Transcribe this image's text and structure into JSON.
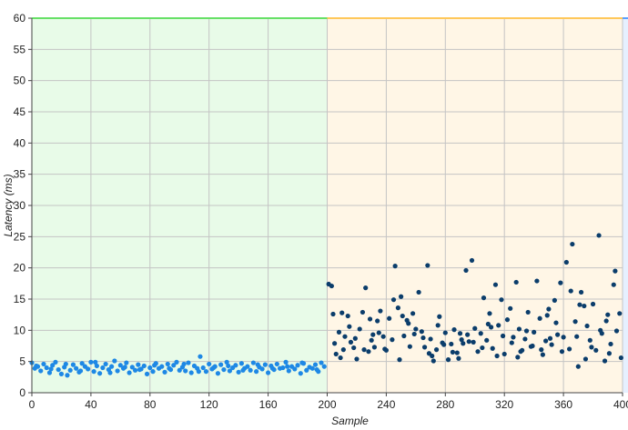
{
  "chart_data": {
    "type": "scatter",
    "xlabel": "Sample",
    "ylabel": "Latency (ms)",
    "xlim": [
      0,
      400
    ],
    "ylim": [
      0,
      60
    ],
    "x_ticks": [
      "0",
      "40",
      "80",
      "120",
      "160",
      "200",
      "240",
      "280",
      "320",
      "360",
      "400"
    ],
    "y_ticks": [
      "0",
      "5",
      "10",
      "15",
      "20",
      "25",
      "30",
      "35",
      "40",
      "45",
      "50",
      "55",
      "60"
    ],
    "grid": true,
    "regions": [
      {
        "x_start": 0,
        "x_end": 200,
        "fill": "#e8fbe8",
        "top_line": "#66e066"
      },
      {
        "x_start": 200,
        "x_end": 400,
        "fill": "#fff6e6",
        "top_line": "#ffc85a"
      },
      {
        "x_start": 400,
        "x_end": 404,
        "fill": "#e6f0ff",
        "top_line": "#5aa0ff"
      }
    ],
    "series": [
      {
        "color": "#1e88e5",
        "points": [
          [
            0,
            4.8
          ],
          [
            2,
            3.9
          ],
          [
            4,
            4.2
          ],
          [
            6,
            3.5
          ],
          [
            8,
            4.6
          ],
          [
            10,
            4.0
          ],
          [
            12,
            3.2
          ],
          [
            14,
            4.4
          ],
          [
            16,
            4.9
          ],
          [
            18,
            3.7
          ],
          [
            20,
            3.0
          ],
          [
            22,
            4.1
          ],
          [
            24,
            2.8
          ],
          [
            26,
            3.6
          ],
          [
            28,
            4.5
          ],
          [
            30,
            3.9
          ],
          [
            32,
            3.3
          ],
          [
            34,
            4.7
          ],
          [
            36,
            4.2
          ],
          [
            38,
            3.8
          ],
          [
            40,
            4.9
          ],
          [
            42,
            3.4
          ],
          [
            44,
            4.3
          ],
          [
            46,
            3.1
          ],
          [
            48,
            4.0
          ],
          [
            50,
            4.6
          ],
          [
            52,
            3.7
          ],
          [
            54,
            4.2
          ],
          [
            56,
            5.1
          ],
          [
            58,
            3.5
          ],
          [
            60,
            4.4
          ],
          [
            62,
            3.9
          ],
          [
            64,
            4.8
          ],
          [
            66,
            3.2
          ],
          [
            68,
            4.1
          ],
          [
            70,
            3.6
          ],
          [
            72,
            4.5
          ],
          [
            74,
            3.8
          ],
          [
            76,
            4.3
          ],
          [
            78,
            3.0
          ],
          [
            80,
            4.0
          ],
          [
            82,
            3.4
          ],
          [
            84,
            4.7
          ],
          [
            86,
            3.9
          ],
          [
            88,
            4.2
          ],
          [
            90,
            3.3
          ],
          [
            92,
            4.6
          ],
          [
            94,
            3.7
          ],
          [
            96,
            4.4
          ],
          [
            98,
            4.9
          ],
          [
            100,
            3.6
          ],
          [
            102,
            4.1
          ],
          [
            104,
            3.5
          ],
          [
            106,
            4.8
          ],
          [
            108,
            3.2
          ],
          [
            110,
            4.3
          ],
          [
            112,
            3.9
          ],
          [
            114,
            5.8
          ],
          [
            116,
            4.0
          ],
          [
            118,
            3.4
          ],
          [
            120,
            4.6
          ],
          [
            122,
            3.8
          ],
          [
            124,
            4.2
          ],
          [
            126,
            3.1
          ],
          [
            128,
            4.5
          ],
          [
            130,
            3.7
          ],
          [
            132,
            4.9
          ],
          [
            134,
            3.5
          ],
          [
            136,
            4.0
          ],
          [
            138,
            4.4
          ],
          [
            140,
            3.3
          ],
          [
            142,
            4.7
          ],
          [
            144,
            3.9
          ],
          [
            146,
            4.2
          ],
          [
            148,
            3.6
          ],
          [
            150,
            4.8
          ],
          [
            152,
            3.4
          ],
          [
            154,
            4.1
          ],
          [
            156,
            3.8
          ],
          [
            158,
            4.5
          ],
          [
            160,
            3.2
          ],
          [
            162,
            4.3
          ],
          [
            164,
            3.7
          ],
          [
            166,
            4.6
          ],
          [
            168,
            3.9
          ],
          [
            170,
            4.0
          ],
          [
            172,
            4.9
          ],
          [
            174,
            3.5
          ],
          [
            176,
            4.2
          ],
          [
            178,
            3.8
          ],
          [
            180,
            4.4
          ],
          [
            182,
            3.1
          ],
          [
            184,
            4.7
          ],
          [
            186,
            3.6
          ],
          [
            188,
            4.1
          ],
          [
            190,
            3.9
          ],
          [
            192,
            4.5
          ],
          [
            194,
            3.4
          ],
          [
            196,
            4.8
          ],
          [
            198,
            4.2
          ],
          [
            3,
            4.3
          ],
          [
            13,
            3.8
          ],
          [
            23,
            4.6
          ],
          [
            33,
            3.5
          ],
          [
            43,
            4.9
          ],
          [
            53,
            3.2
          ],
          [
            63,
            4.1
          ],
          [
            73,
            3.7
          ],
          [
            83,
            4.4
          ],
          [
            93,
            3.9
          ],
          [
            103,
            4.6
          ],
          [
            113,
            3.4
          ],
          [
            123,
            4.0
          ],
          [
            133,
            4.3
          ],
          [
            143,
            3.6
          ],
          [
            153,
            4.5
          ],
          [
            163,
            3.9
          ],
          [
            173,
            4.2
          ],
          [
            183,
            4.8
          ],
          [
            193,
            3.7
          ]
        ]
      },
      {
        "color": "#0b3d6b",
        "points": [
          [
            201,
            17.4
          ],
          [
            203,
            17.1
          ],
          [
            204,
            12.6
          ],
          [
            206,
            6.2
          ],
          [
            208,
            9.7
          ],
          [
            210,
            12.8
          ],
          [
            212,
            9.0
          ],
          [
            214,
            12.3
          ],
          [
            216,
            8.1
          ],
          [
            218,
            7.2
          ],
          [
            220,
            5.4
          ],
          [
            222,
            10.2
          ],
          [
            224,
            12.9
          ],
          [
            226,
            16.8
          ],
          [
            228,
            6.6
          ],
          [
            230,
            8.4
          ],
          [
            232,
            7.3
          ],
          [
            234,
            11.5
          ],
          [
            236,
            13.1
          ],
          [
            238,
            9.0
          ],
          [
            240,
            6.8
          ],
          [
            242,
            11.9
          ],
          [
            244,
            8.5
          ],
          [
            246,
            20.3
          ],
          [
            248,
            13.6
          ],
          [
            250,
            15.4
          ],
          [
            252,
            9.1
          ],
          [
            254,
            11.6
          ],
          [
            256,
            7.4
          ],
          [
            258,
            12.7
          ],
          [
            260,
            10.2
          ],
          [
            262,
            16.1
          ],
          [
            264,
            9.8
          ],
          [
            266,
            7.3
          ],
          [
            268,
            20.4
          ],
          [
            270,
            8.6
          ],
          [
            272,
            5.1
          ],
          [
            274,
            6.9
          ],
          [
            276,
            12.2
          ],
          [
            278,
            8.0
          ],
          [
            280,
            9.6
          ],
          [
            282,
            5.3
          ],
          [
            284,
            7.8
          ],
          [
            286,
            10.1
          ],
          [
            288,
            6.4
          ],
          [
            290,
            9.5
          ],
          [
            292,
            7.9
          ],
          [
            294,
            19.6
          ],
          [
            296,
            8.2
          ],
          [
            298,
            21.2
          ],
          [
            300,
            10.3
          ],
          [
            302,
            6.6
          ],
          [
            304,
            9.5
          ],
          [
            306,
            15.2
          ],
          [
            308,
            8.4
          ],
          [
            310,
            12.7
          ],
          [
            312,
            7.1
          ],
          [
            314,
            17.3
          ],
          [
            316,
            10.8
          ],
          [
            318,
            14.9
          ],
          [
            320,
            6.2
          ],
          [
            322,
            11.7
          ],
          [
            324,
            13.5
          ],
          [
            326,
            8.9
          ],
          [
            328,
            17.7
          ],
          [
            330,
            10.2
          ],
          [
            332,
            6.8
          ],
          [
            334,
            8.6
          ],
          [
            336,
            12.9
          ],
          [
            338,
            7.4
          ],
          [
            340,
            9.7
          ],
          [
            342,
            17.9
          ],
          [
            344,
            11.9
          ],
          [
            346,
            6.1
          ],
          [
            348,
            8.3
          ],
          [
            350,
            13.4
          ],
          [
            352,
            7.7
          ],
          [
            354,
            14.8
          ],
          [
            356,
            9.3
          ],
          [
            358,
            17.6
          ],
          [
            360,
            8.9
          ],
          [
            362,
            20.9
          ],
          [
            364,
            7.0
          ],
          [
            366,
            23.8
          ],
          [
            368,
            11.4
          ],
          [
            370,
            4.2
          ],
          [
            372,
            16.1
          ],
          [
            374,
            13.9
          ],
          [
            376,
            10.7
          ],
          [
            378,
            8.4
          ],
          [
            380,
            14.2
          ],
          [
            382,
            6.8
          ],
          [
            384,
            25.2
          ],
          [
            386,
            9.5
          ],
          [
            388,
            5.1
          ],
          [
            390,
            12.5
          ],
          [
            392,
            7.8
          ],
          [
            394,
            17.3
          ],
          [
            396,
            9.9
          ],
          [
            398,
            12.7
          ],
          [
            205,
            7.9
          ],
          [
            215,
            10.6
          ],
          [
            225,
            6.9
          ],
          [
            235,
            9.6
          ],
          [
            245,
            14.9
          ],
          [
            255,
            11.1
          ],
          [
            265,
            8.8
          ],
          [
            275,
            10.8
          ],
          [
            285,
            6.5
          ],
          [
            295,
            9.3
          ],
          [
            305,
            7.2
          ],
          [
            315,
            5.9
          ],
          [
            325,
            8.0
          ],
          [
            335,
            9.9
          ],
          [
            345,
            6.9
          ],
          [
            355,
            11.2
          ],
          [
            365,
            16.3
          ],
          [
            375,
            5.4
          ],
          [
            385,
            10.0
          ],
          [
            395,
            19.5
          ],
          [
            209,
            5.6
          ],
          [
            219,
            8.7
          ],
          [
            229,
            11.8
          ],
          [
            239,
            7.0
          ],
          [
            249,
            5.3
          ],
          [
            259,
            9.4
          ],
          [
            269,
            6.3
          ],
          [
            279,
            7.7
          ],
          [
            289,
            5.5
          ],
          [
            299,
            8.1
          ],
          [
            309,
            11.0
          ],
          [
            319,
            9.1
          ],
          [
            329,
            5.7
          ],
          [
            339,
            7.5
          ],
          [
            349,
            12.4
          ],
          [
            359,
            6.6
          ],
          [
            369,
            9.0
          ],
          [
            379,
            7.3
          ],
          [
            389,
            11.5
          ],
          [
            399,
            5.6
          ],
          [
            211,
            6.9
          ],
          [
            231,
            9.3
          ],
          [
            251,
            12.3
          ],
          [
            271,
            5.9
          ],
          [
            291,
            8.5
          ],
          [
            311,
            10.5
          ],
          [
            331,
            6.6
          ],
          [
            351,
            8.7
          ],
          [
            371,
            14.1
          ],
          [
            391,
            6.3
          ]
        ]
      }
    ]
  }
}
